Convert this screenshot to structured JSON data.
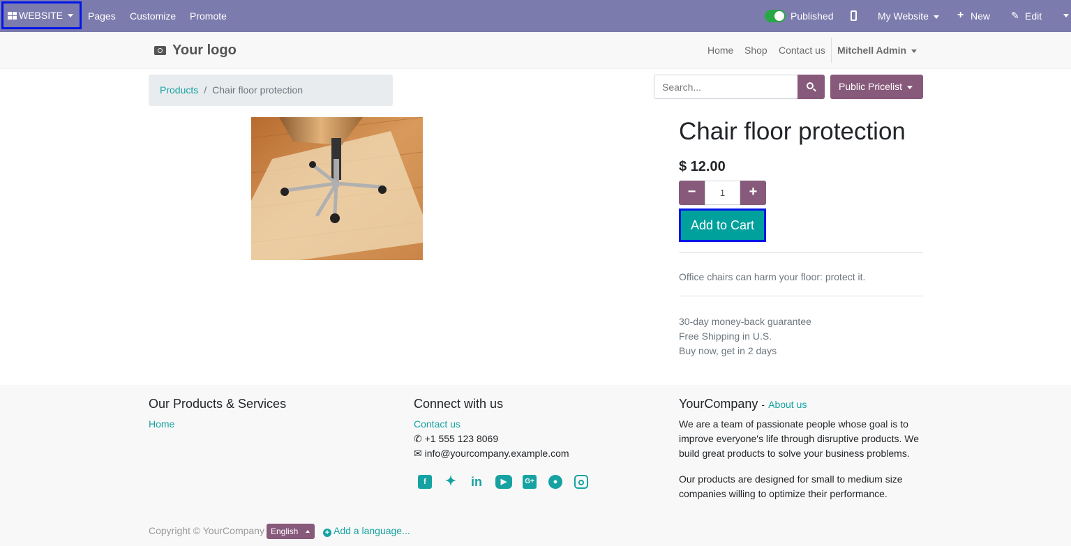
{
  "admin_bar": {
    "website_menu": "WEBSITE",
    "pages": "Pages",
    "customize": "Customize",
    "promote": "Promote",
    "published": "Published",
    "my_website": "My Website",
    "new": "New",
    "edit": "Edit"
  },
  "header": {
    "logo_text": "Your logo",
    "nav": [
      "Home",
      "Shop",
      "Contact us"
    ],
    "user": "Mitchell Admin"
  },
  "breadcrumb": {
    "parent": "Products",
    "separator": "/",
    "current": "Chair floor protection"
  },
  "search": {
    "placeholder": "Search...",
    "pricelist": "Public Pricelist"
  },
  "product": {
    "name": "Chair floor protection",
    "price": "$ 12.00",
    "quantity": "1",
    "minus": "−",
    "plus": "+",
    "add_to_cart": "Add to Cart",
    "description": "Office chairs can harm your floor: protect it.",
    "perks": [
      "30-day money-back guarantee",
      "Free Shipping in U.S.",
      "Buy now, get in 2 days"
    ]
  },
  "footer": {
    "col1_title": "Our Products & Services",
    "col1_link": "Home",
    "col2_title": "Connect with us",
    "contact_link": "Contact us",
    "phone": "+1 555 123 8069",
    "email": "info@yourcompany.example.com",
    "social_icons": [
      "facebook-icon",
      "twitter-icon",
      "linkedin-icon",
      "youtube-icon",
      "google-plus-icon",
      "github-icon",
      "instagram-icon"
    ],
    "col3_title": "YourCompany",
    "col3_dash": "-",
    "about_link": "About us",
    "about_p1": "We are a team of passionate people whose goal is to improve everyone's life through disruptive products. We build great products to solve your business problems.",
    "about_p2": "Our products are designed for small to medium size companies willing to optimize their performance.",
    "copyright": "Copyright © YourCompany",
    "language": "English",
    "add_language": "Add a language..."
  },
  "colors": {
    "admin_bar": "#7c7bad",
    "brand": "#875a7b",
    "accent": "#00a09d",
    "link": "#17a2a2",
    "focus_outline": "#0016e6"
  }
}
